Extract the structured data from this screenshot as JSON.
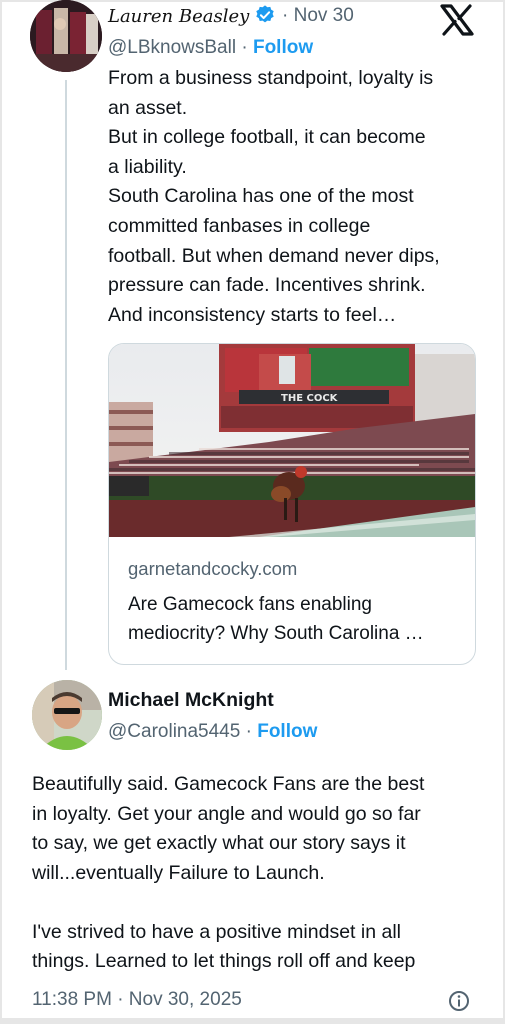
{
  "tweet": {
    "author_name": "Lauren Beasley",
    "handle": "@LBknowsBall",
    "separator": "·",
    "date": "Nov 30",
    "follow_label": "Follow",
    "text_lines": [
      "From a business standpoint, loyalty is",
      "an asset.",
      "But in college football, it can become",
      "a liability.",
      "South Carolina has one of the most",
      "committed fanbases in college",
      "football. But when demand never dips,",
      "pressure can fade. Incentives shrink.",
      "And inconsistency starts to feel…"
    ],
    "link_card": {
      "domain": "garnetandcocky.com",
      "title_lines": [
        "Are Gamecock fans enabling",
        "mediocrity? Why South Carolina …"
      ],
      "image_text": "THE COCK"
    }
  },
  "reply": {
    "author_name": "Michael McKnight",
    "handle": "@Carolina5445",
    "separator": "·",
    "follow_label": "Follow",
    "text_lines": [
      "Beautifully said.  Gamecock Fans are the best",
      "in loyalty.  Get your angle and would go so far",
      "to say, we get exactly what our story says it",
      "will...eventually Failure to Launch.",
      "",
      "I've strived to have a positive mindset in all",
      "things.  Learned to let things roll off and keep"
    ],
    "timestamp": "11:38 PM · Nov 30, 2025"
  },
  "colors": {
    "accent": "#1d9bf0",
    "secondary_text": "#536471",
    "primary_text": "#0f1419",
    "border": "#cfd9de"
  },
  "icons": [
    "verified-badge-icon",
    "x-logo-icon",
    "info-icon"
  ]
}
